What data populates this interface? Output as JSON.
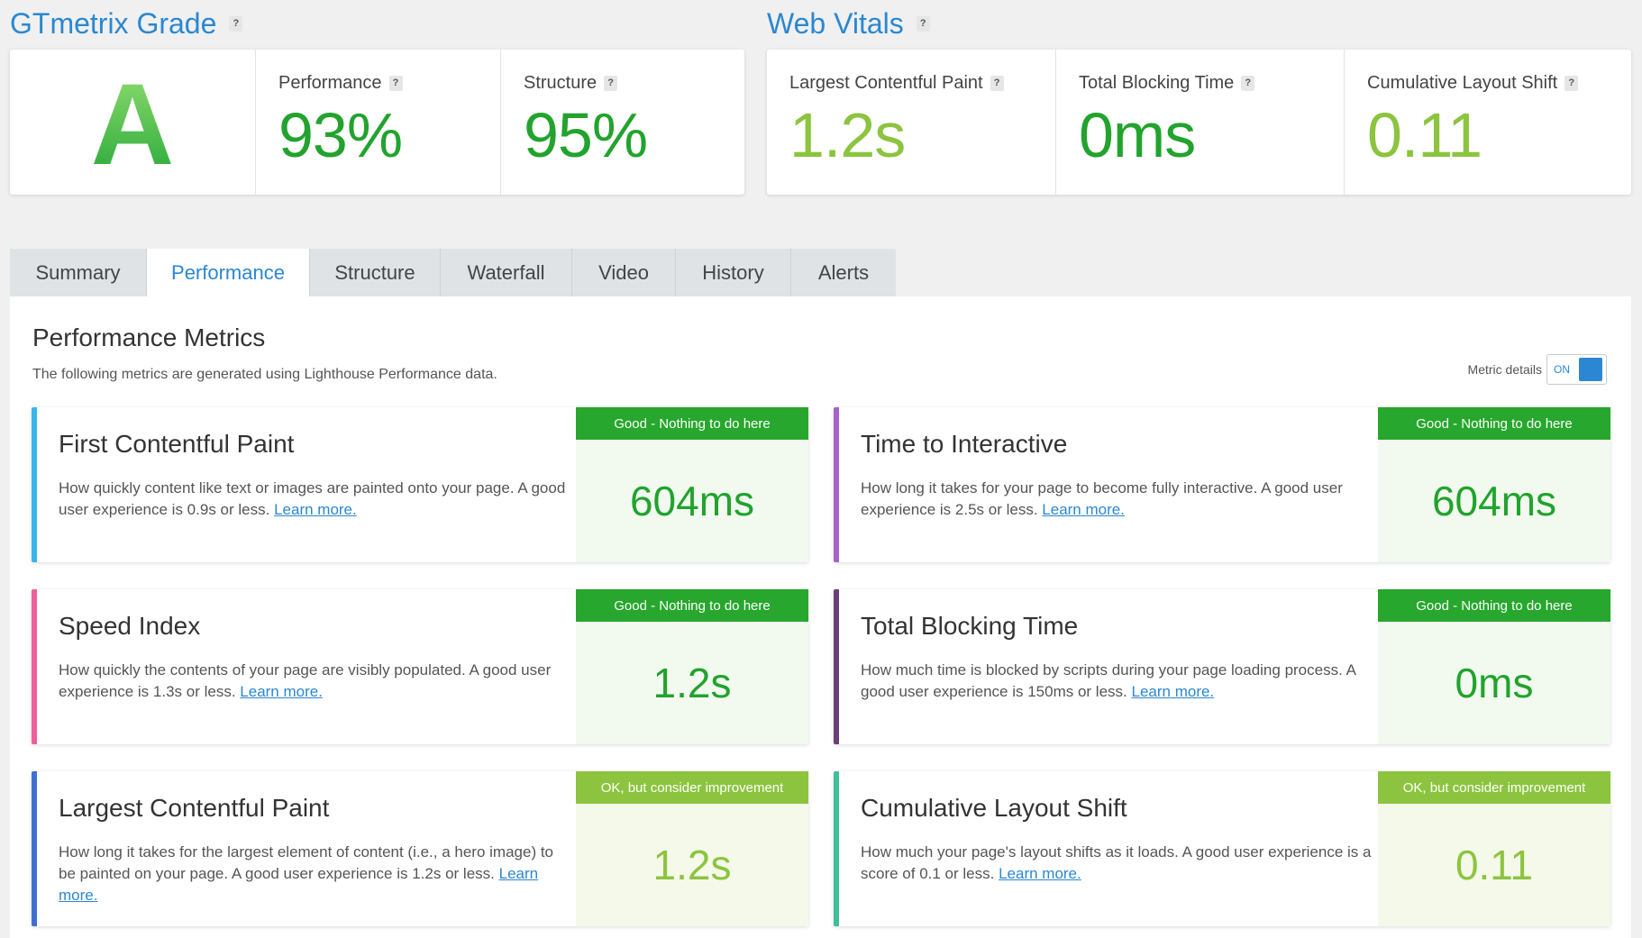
{
  "grade_section": {
    "title": "GTmetrix Grade",
    "help": "?",
    "grade": "A",
    "performance_label": "Performance",
    "performance_value": "93%",
    "structure_label": "Structure",
    "structure_value": "95%"
  },
  "vitals_section": {
    "title": "Web Vitals",
    "help": "?",
    "lcp_label": "Largest Contentful Paint",
    "lcp_value": "1.2s",
    "tbt_label": "Total Blocking Time",
    "tbt_value": "0ms",
    "cls_label": "Cumulative Layout Shift",
    "cls_value": "0.11"
  },
  "tabs": [
    "Summary",
    "Performance",
    "Structure",
    "Waterfall",
    "Video",
    "History",
    "Alerts"
  ],
  "active_tab": "Performance",
  "content": {
    "title": "Performance Metrics",
    "subtitle": "The following metrics are generated using Lighthouse Performance data.",
    "toggle_label": "Metric details",
    "toggle_state": "ON"
  },
  "metrics": [
    {
      "title": "First Contentful Paint",
      "desc": "How quickly content like text or images are painted onto your page. A good user experience is 0.9s or less.",
      "link": "Learn more.",
      "badge": "Good - Nothing to do here",
      "value": "604ms",
      "status": "good",
      "bar_color": "#39b6ec"
    },
    {
      "title": "Time to Interactive",
      "desc": "How long it takes for your page to become fully interactive. A good user experience is 2.5s or less.",
      "link": "Learn more.",
      "badge": "Good - Nothing to do here",
      "value": "604ms",
      "status": "good",
      "bar_color": "#a662c9"
    },
    {
      "title": "Speed Index",
      "desc": "How quickly the contents of your page are visibly populated. A good user experience is 1.3s or less.",
      "link": "Learn more.",
      "badge": "Good - Nothing to do here",
      "value": "1.2s",
      "status": "good",
      "bar_color": "#ef5f98"
    },
    {
      "title": "Total Blocking Time",
      "desc": "How much time is blocked by scripts during your page loading process. A good user experience is 150ms or less.",
      "link": "Learn more.",
      "badge": "Good - Nothing to do here",
      "value": "0ms",
      "status": "good",
      "bar_color": "#6a3f78"
    },
    {
      "title": "Largest Contentful Paint",
      "desc": "How long it takes for the largest element of content (i.e., a hero image) to be painted on your page. A good user experience is 1.2s or less.",
      "link": "Learn more.",
      "badge": "OK, but consider improvement",
      "value": "1.2s",
      "status": "ok",
      "bar_color": "#3f6fd0"
    },
    {
      "title": "Cumulative Layout Shift",
      "desc": "How much your page's layout shifts as it loads. A good user experience is a score of 0.1 or less.",
      "link": "Learn more.",
      "badge": "OK, but consider improvement",
      "value": "0.11",
      "status": "ok",
      "bar_color": "#3fbf9a"
    }
  ]
}
